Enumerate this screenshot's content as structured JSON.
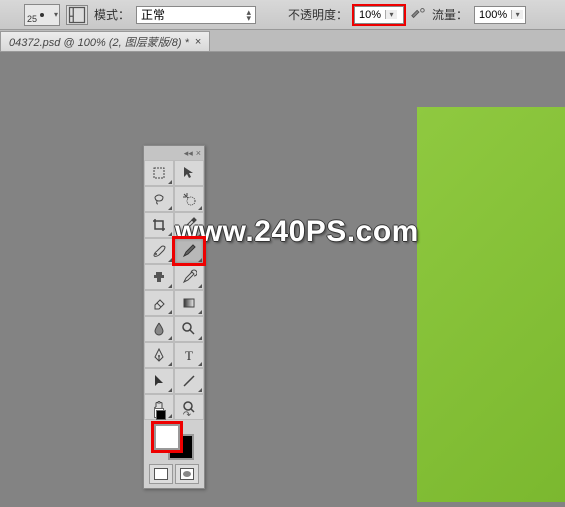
{
  "optionsBar": {
    "brushSize": "25",
    "modeLabel": "模式：",
    "modeValue": "正常",
    "opacityLabel": "不透明度：",
    "opacityValue": "10%",
    "flowLabel": "流量：",
    "flowValue": "100%"
  },
  "docTab": {
    "title": "04372.psd @ 100% (2, 图层蒙版/8) *",
    "close": "×"
  },
  "toolPanel": {
    "collapse": "◂◂",
    "close": "×"
  },
  "tools": [
    {
      "name": "rectangular-marquee",
      "row": 0,
      "col": 0
    },
    {
      "name": "move",
      "row": 0,
      "col": 1
    },
    {
      "name": "lasso",
      "row": 1,
      "col": 0
    },
    {
      "name": "magic-wand",
      "row": 1,
      "col": 1
    },
    {
      "name": "crop",
      "row": 2,
      "col": 0
    },
    {
      "name": "eyedropper",
      "row": 2,
      "col": 1
    },
    {
      "name": "healing-brush",
      "row": 3,
      "col": 0
    },
    {
      "name": "brush",
      "row": 3,
      "col": 1,
      "selected": true,
      "highlight": true
    },
    {
      "name": "clone-stamp",
      "row": 4,
      "col": 0
    },
    {
      "name": "history-brush",
      "row": 4,
      "col": 1
    },
    {
      "name": "eraser",
      "row": 5,
      "col": 0
    },
    {
      "name": "gradient",
      "row": 5,
      "col": 1
    },
    {
      "name": "blur",
      "row": 6,
      "col": 0
    },
    {
      "name": "dodge",
      "row": 6,
      "col": 1
    },
    {
      "name": "pen",
      "row": 7,
      "col": 0
    },
    {
      "name": "type",
      "row": 7,
      "col": 1
    },
    {
      "name": "path-selection",
      "row": 8,
      "col": 0
    },
    {
      "name": "line",
      "row": 8,
      "col": 1
    },
    {
      "name": "hand",
      "row": 9,
      "col": 0
    },
    {
      "name": "zoom",
      "row": 9,
      "col": 1
    }
  ],
  "colors": {
    "foreground": "#ffffff",
    "background": "#000000"
  },
  "watermark": "www.240PS.com"
}
